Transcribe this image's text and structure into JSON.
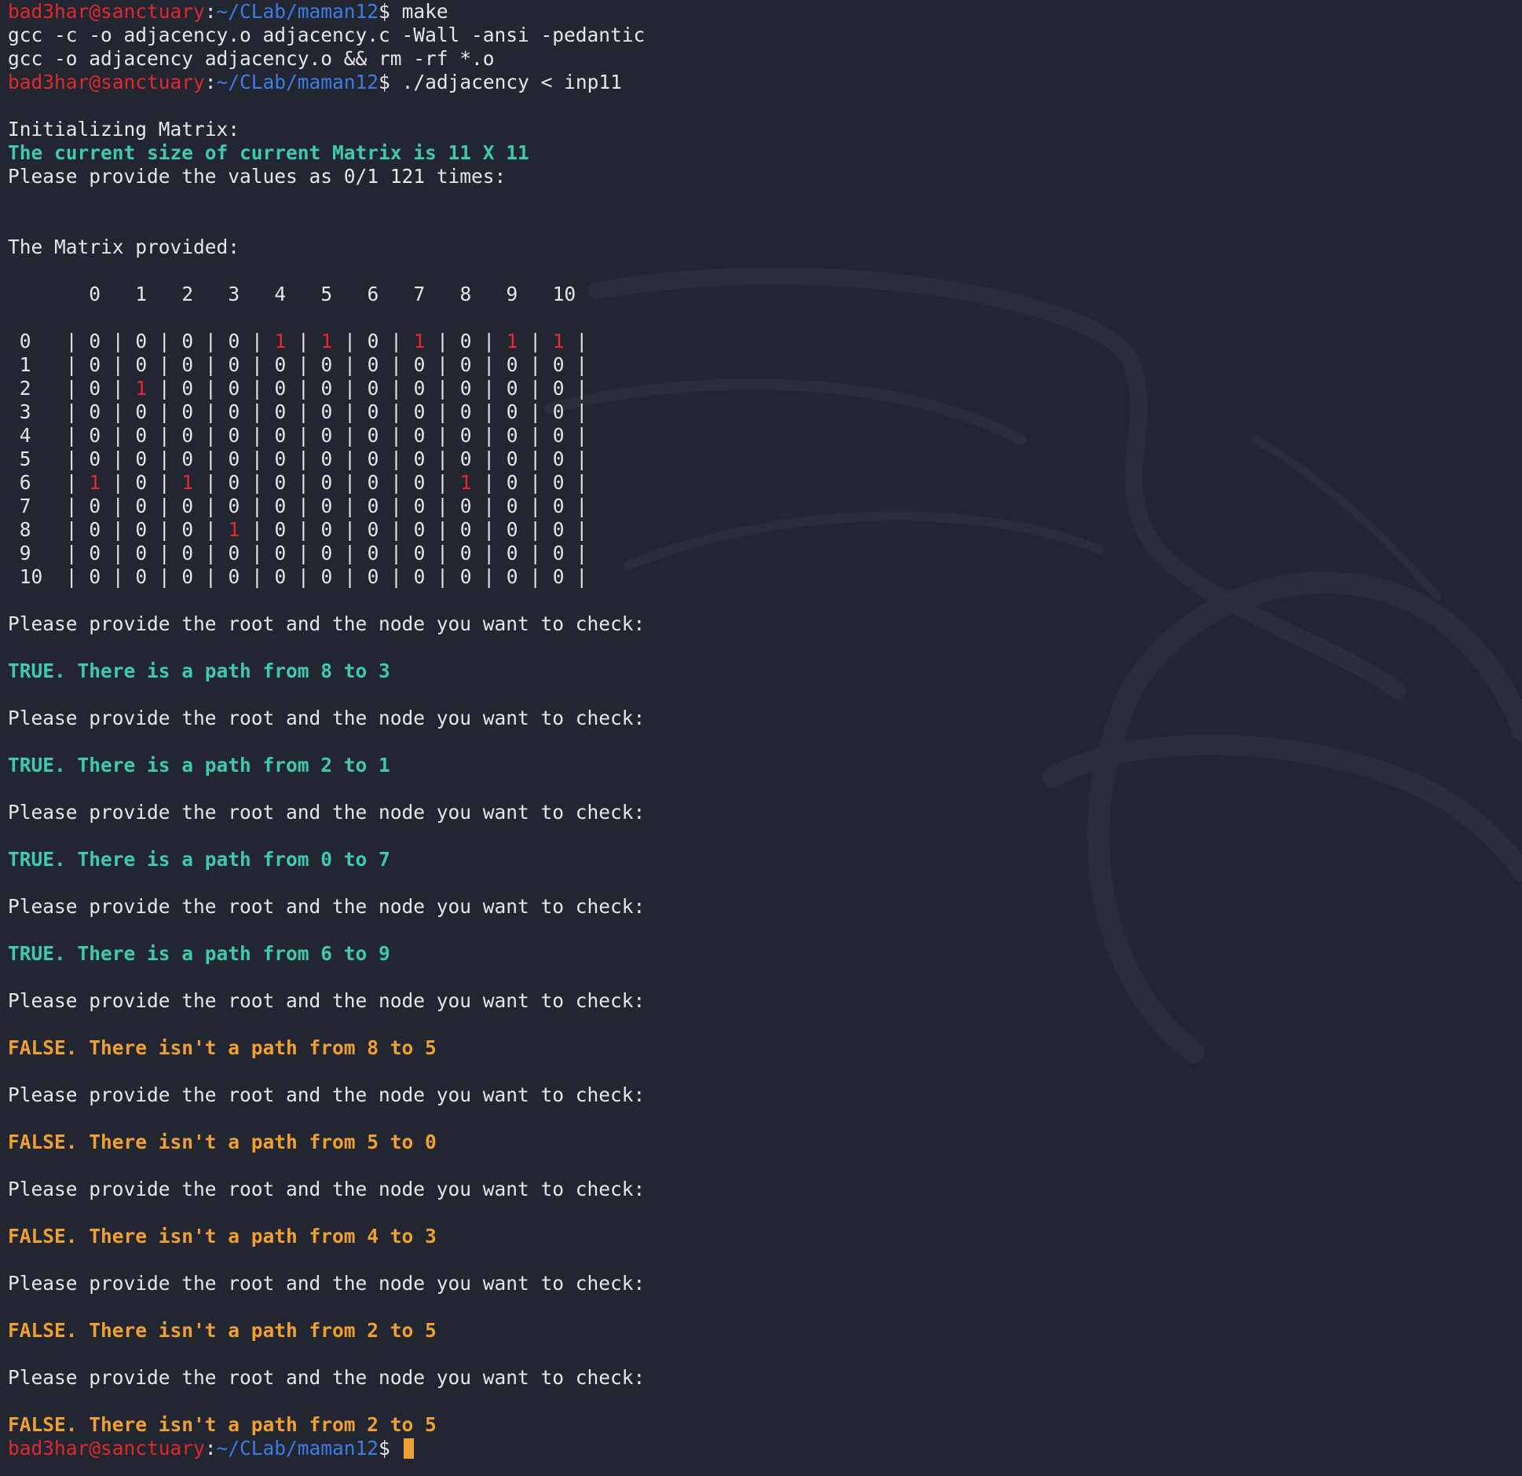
{
  "prompt": {
    "user_host": "bad3har@sanctuary",
    "colon": ":",
    "path": "~/CLab/maman12",
    "dollar": "$"
  },
  "commands": [
    "make",
    "./adjacency < inp11"
  ],
  "build_output": [
    "gcc -c -o adjacency.o adjacency.c -Wall -ansi -pedantic",
    "gcc -o adjacency adjacency.o && rm -rf *.o"
  ],
  "init_text": "Initializing Matrix:",
  "size_text": "The current size of current Matrix is 11 X 11",
  "provide_values_text": "Please provide the values as 0/1 121 times:",
  "matrix_heading": "The Matrix provided:",
  "matrix": {
    "column_headers": [
      "0",
      "1",
      "2",
      "3",
      "4",
      "5",
      "6",
      "7",
      "8",
      "9",
      "10"
    ],
    "row_labels": [
      "0",
      "1",
      "2",
      "3",
      "4",
      "5",
      "6",
      "7",
      "8",
      "9",
      "10"
    ],
    "rows": [
      [
        0,
        0,
        0,
        0,
        1,
        1,
        0,
        1,
        0,
        1,
        1
      ],
      [
        0,
        0,
        0,
        0,
        0,
        0,
        0,
        0,
        0,
        0,
        0
      ],
      [
        0,
        1,
        0,
        0,
        0,
        0,
        0,
        0,
        0,
        0,
        0
      ],
      [
        0,
        0,
        0,
        0,
        0,
        0,
        0,
        0,
        0,
        0,
        0
      ],
      [
        0,
        0,
        0,
        0,
        0,
        0,
        0,
        0,
        0,
        0,
        0
      ],
      [
        0,
        0,
        0,
        0,
        0,
        0,
        0,
        0,
        0,
        0,
        0
      ],
      [
        1,
        0,
        1,
        0,
        0,
        0,
        0,
        0,
        1,
        0,
        0
      ],
      [
        0,
        0,
        0,
        0,
        0,
        0,
        0,
        0,
        0,
        0,
        0
      ],
      [
        0,
        0,
        0,
        1,
        0,
        0,
        0,
        0,
        0,
        0,
        0
      ],
      [
        0,
        0,
        0,
        0,
        0,
        0,
        0,
        0,
        0,
        0,
        0
      ],
      [
        0,
        0,
        0,
        0,
        0,
        0,
        0,
        0,
        0,
        0,
        0
      ]
    ]
  },
  "query_prompt": "Please provide the root and the node you want to check:",
  "results": [
    {
      "type": "true",
      "text": "TRUE. There is a path from 8 to 3"
    },
    {
      "type": "true",
      "text": "TRUE. There is a path from 2 to 1"
    },
    {
      "type": "true",
      "text": "TRUE. There is a path from 0 to 7"
    },
    {
      "type": "true",
      "text": "TRUE. There is a path from 6 to 9"
    },
    {
      "type": "false",
      "text": "FALSE. There isn't a path from 8 to 5"
    },
    {
      "type": "false",
      "text": "FALSE. There isn't a path from 5 to 0"
    },
    {
      "type": "false",
      "text": "FALSE. There isn't a path from 4 to 3"
    },
    {
      "type": "false",
      "text": "FALSE. There isn't a path from 2 to 5"
    },
    {
      "type": "false",
      "text": "FALSE. There isn't a path from 2 to 5"
    }
  ],
  "colors": {
    "background": "#222630",
    "user": "#e0282e",
    "path": "#3d7be6",
    "true": "#3ec9b0",
    "false": "#f0a030",
    "highlight_one": "#e8282e",
    "cursor": "#f0a030"
  },
  "icons": {
    "background": "kali-dragon-icon"
  }
}
